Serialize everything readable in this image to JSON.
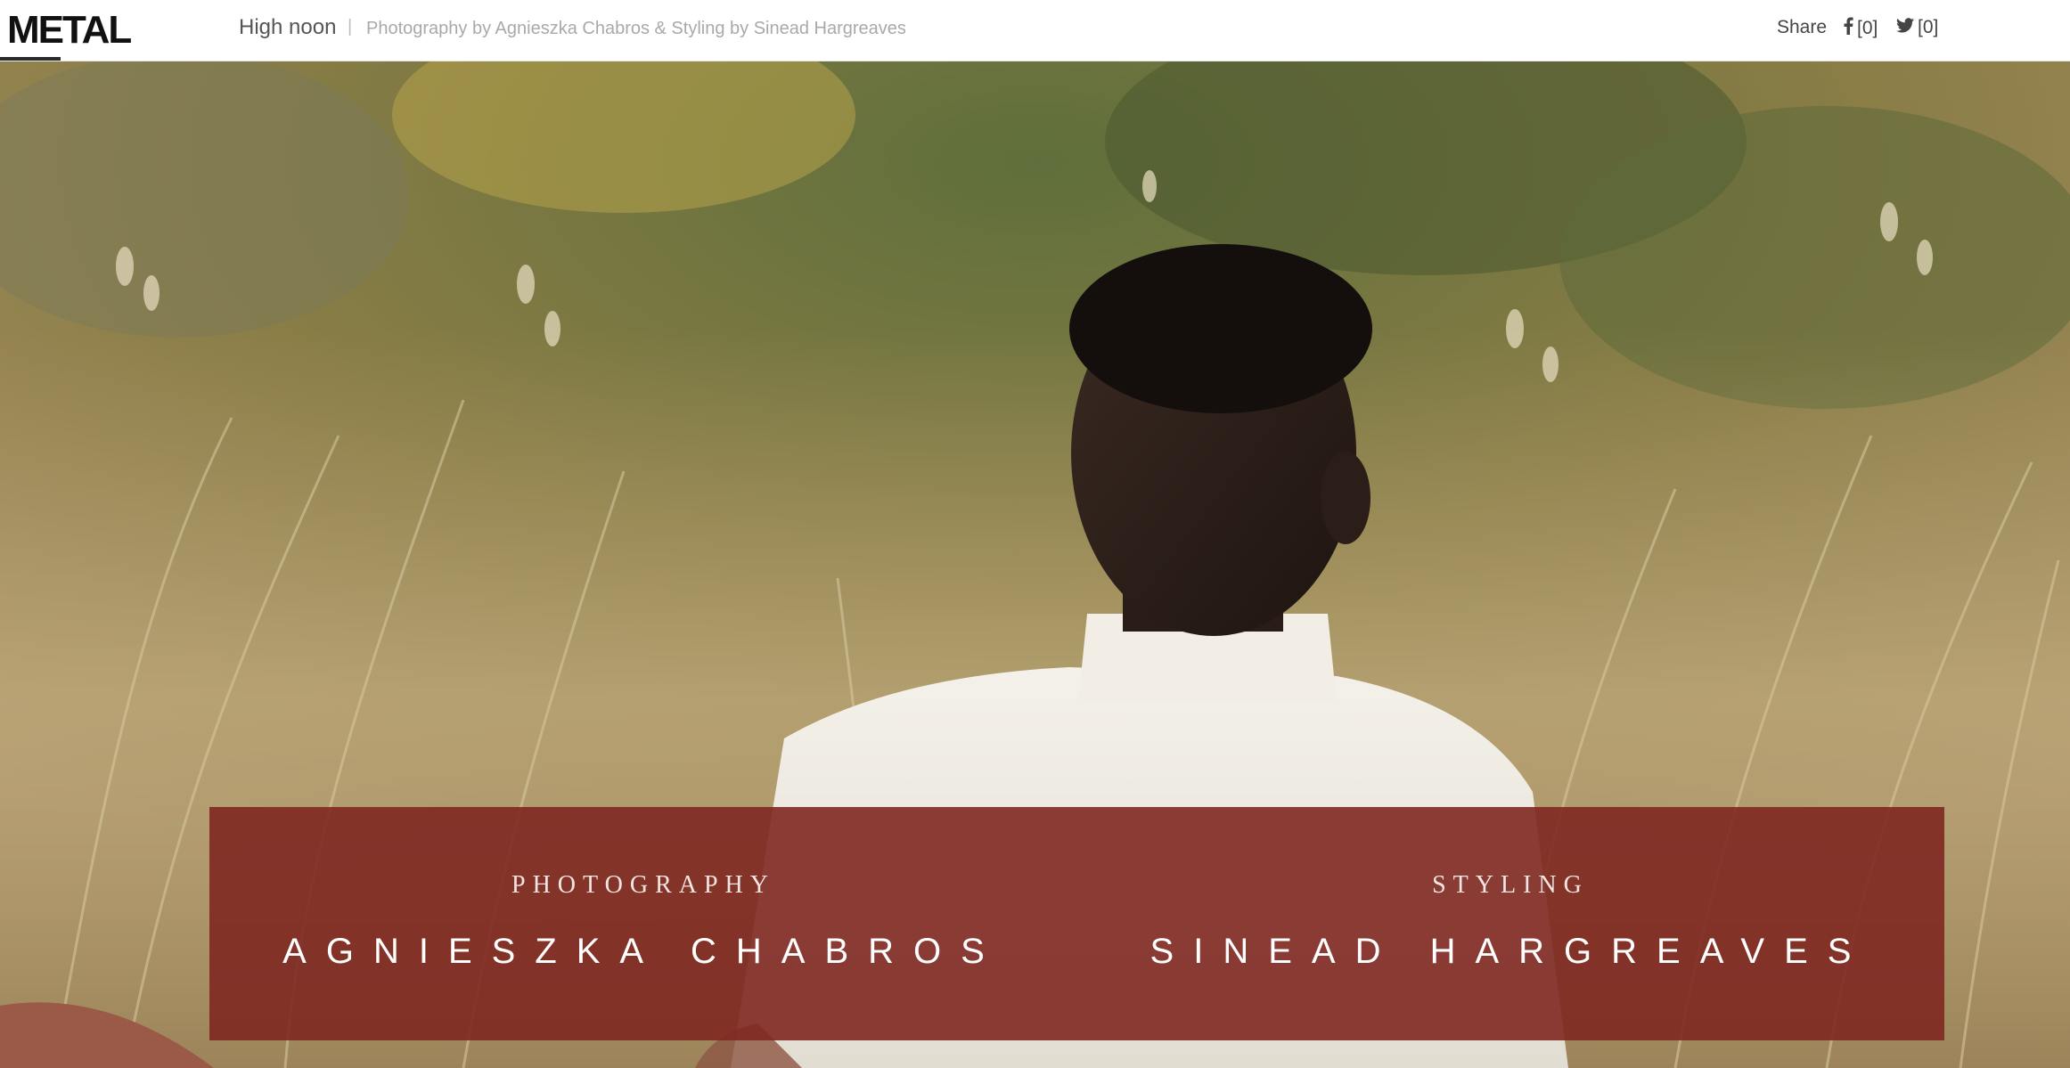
{
  "header": {
    "logo": "METAL",
    "title": "High noon",
    "separator": "|",
    "credits": "Photography by Agnieszka Chabros  &  Styling by Sinead Hargreaves",
    "share_label": "Share",
    "facebook_count": "[0]",
    "twitter_count": "[0]"
  },
  "hero": {
    "photography_role": "PHOTOGRAPHY",
    "photographer": "AGNIESZKA CHABROS",
    "styling_role": "STYLING",
    "stylist": "SINEAD HARGREAVES"
  },
  "colors": {
    "credit_box": "#7e2821",
    "header_text": "#555555",
    "credits_text": "#a9a9a9"
  },
  "icons": {
    "facebook": "facebook-icon",
    "twitter": "twitter-icon"
  }
}
